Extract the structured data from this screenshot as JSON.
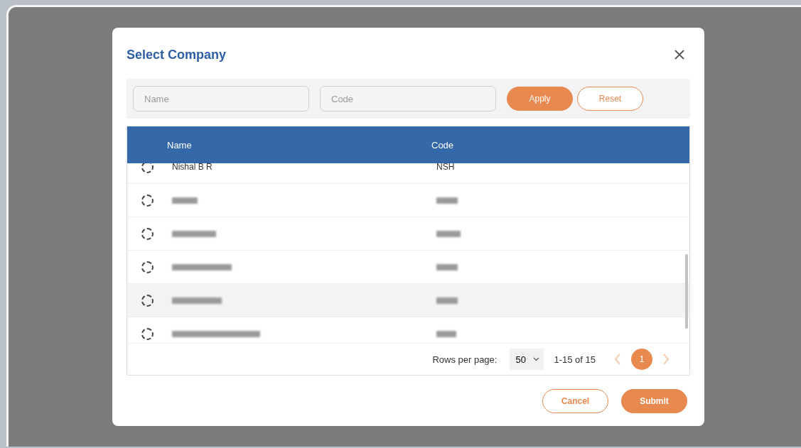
{
  "dialog": {
    "title": "Select Company"
  },
  "filters": {
    "fields": [
      {
        "placeholder": "Name"
      },
      {
        "placeholder": "Code"
      }
    ],
    "apply": "Apply",
    "reset": "Reset"
  },
  "table": {
    "columns": [
      "Name",
      "Code"
    ],
    "rows": [
      {
        "kind": "text",
        "name": "Nishal B R",
        "code": "NSH",
        "selected": false,
        "highlighted": false
      },
      {
        "kind": "redacted",
        "selected": false,
        "highlighted": false
      },
      {
        "kind": "redacted",
        "selected": false,
        "highlighted": false
      },
      {
        "kind": "redacted",
        "selected": false,
        "highlighted": false
      },
      {
        "kind": "redacted",
        "selected": false,
        "highlighted": true
      },
      {
        "kind": "redacted",
        "selected": false,
        "highlighted": false
      }
    ],
    "pagination": {
      "rows_per_page_label": "Rows per page:",
      "rows_per_page": "50",
      "range": "1-15 of 15",
      "pages": [
        {
          "label": "1",
          "selected": true
        }
      ]
    }
  },
  "buttons": {
    "cancel": "Cancel",
    "submit": "Submit"
  }
}
